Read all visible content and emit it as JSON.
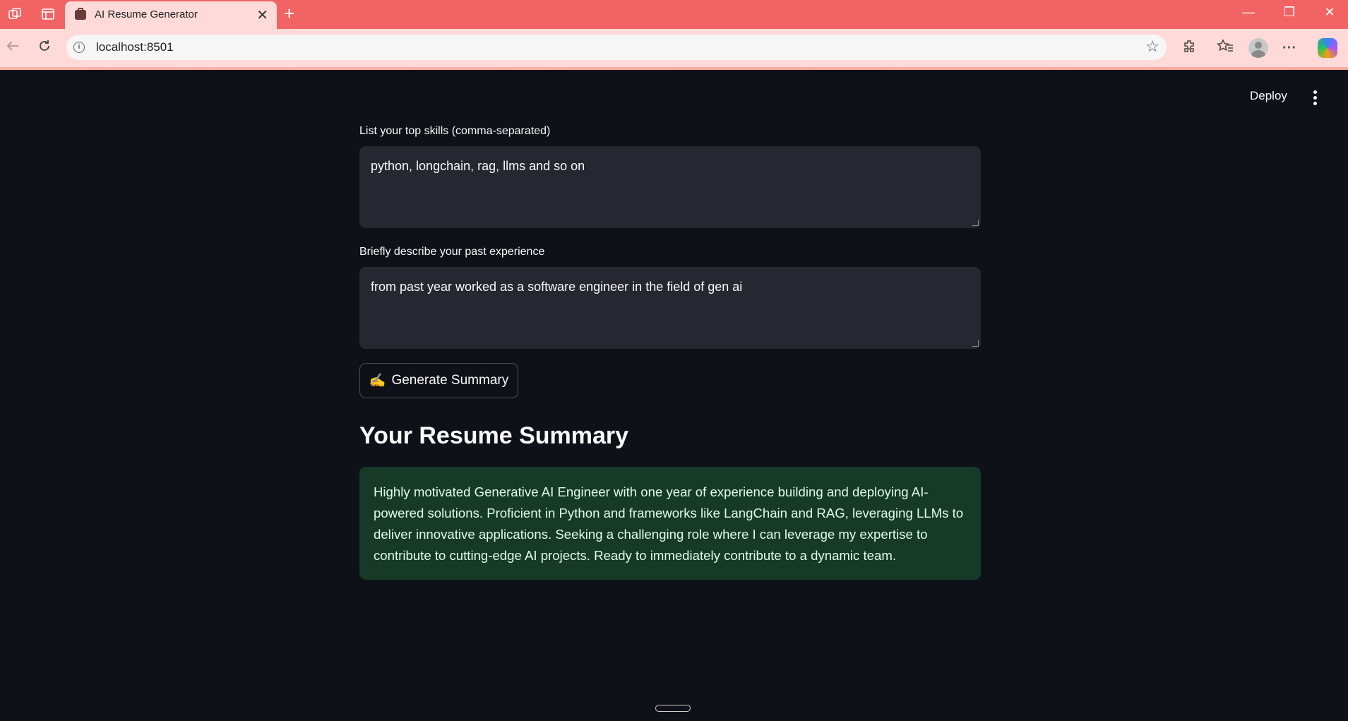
{
  "browser": {
    "tab_title": "AI Resume Generator",
    "tab_close": "✕",
    "new_tab": "+",
    "url": "localhost:8501",
    "controls": {
      "minimize": "—",
      "restore": "❐",
      "close": "✕"
    }
  },
  "app": {
    "deploy_label": "Deploy",
    "skills": {
      "label": "List your top skills (comma-separated)",
      "value": "python, longchain, rag, llms and so on"
    },
    "experience": {
      "label": "Briefly describe your past experience",
      "value": "from past year worked as a software engineer in the field of gen ai"
    },
    "generate_button": {
      "icon": "✍️",
      "label": "Generate Summary"
    },
    "summary": {
      "heading": "Your Resume Summary",
      "text": "Highly motivated Generative AI Engineer with one year of experience building and deploying AI-powered solutions. Proficient in Python and frameworks like LangChain and RAG, leveraging LLMs to deliver innovative applications. Seeking a challenging role where I can leverage my expertise to contribute to cutting-edge AI projects. Ready to immediately contribute to a dynamic team."
    }
  },
  "colors": {
    "tabstrip": "#f26464",
    "toolbar": "#ffdad8",
    "app_background": "#0e1117",
    "input_background": "#262730",
    "summary_background": "#173928",
    "summary_text": "#dffde9"
  }
}
